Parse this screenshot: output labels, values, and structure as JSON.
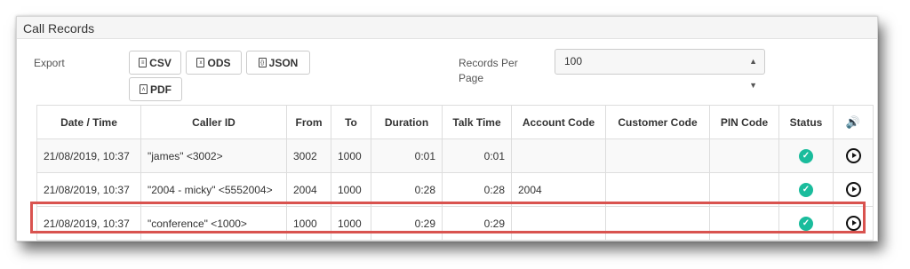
{
  "panel": {
    "title": "Call Records"
  },
  "export": {
    "label": "Export",
    "buttons": [
      {
        "label": "CSV",
        "icon": "csv-file-icon"
      },
      {
        "label": "ODS",
        "icon": "ods-file-icon"
      },
      {
        "label": "JSON",
        "icon": "json-file-icon"
      },
      {
        "label": "PDF",
        "icon": "pdf-file-icon"
      }
    ]
  },
  "records_per_page": {
    "label": "Records Per Page",
    "value": "100"
  },
  "table": {
    "headers": [
      "Date / Time",
      "Caller ID",
      "From",
      "To",
      "Duration",
      "Talk Time",
      "Account Code",
      "Customer Code",
      "PIN Code",
      "Status"
    ],
    "recording_header_icon": "speaker-icon",
    "rows": [
      {
        "datetime": "21/08/2019, 10:37",
        "caller_id": "\"james\" <3002>",
        "from": "3002",
        "to": "1000",
        "duration": "0:01",
        "talk_time": "0:01",
        "account_code": "",
        "customer_code": "",
        "pin_code": "",
        "status": "answered",
        "status_icon": "check-circle-icon",
        "recording_icon": "play-icon"
      },
      {
        "datetime": "21/08/2019, 10:37",
        "caller_id": "\"2004 - micky\" <5552004>",
        "from": "2004",
        "to": "1000",
        "duration": "0:28",
        "talk_time": "0:28",
        "account_code": "2004",
        "customer_code": "",
        "pin_code": "",
        "status": "answered",
        "status_icon": "check-circle-icon",
        "recording_icon": "play-icon"
      },
      {
        "datetime": "21/08/2019, 10:37",
        "caller_id": "\"conference\" <1000>",
        "from": "1000",
        "to": "1000",
        "duration": "0:29",
        "talk_time": "0:29",
        "account_code": "",
        "customer_code": "",
        "pin_code": "",
        "status": "answered",
        "status_icon": "check-circle-icon",
        "recording_icon": "play-icon"
      }
    ]
  },
  "colors": {
    "status_ok": "#1abc9c",
    "highlight": "#d9534f"
  }
}
